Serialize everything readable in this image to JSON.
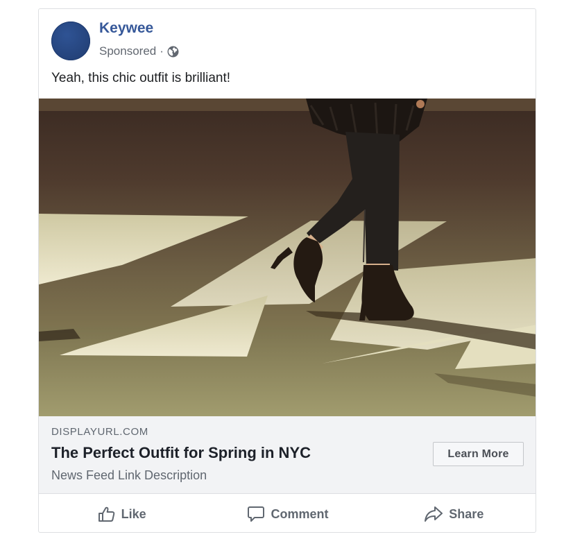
{
  "post": {
    "page_name": "Keywee",
    "sponsored": "Sponsored",
    "separator": "·",
    "privacy_icon": "globe-icon",
    "text": "Yeah, this chic outfit is brilliant!",
    "image_icon": "photo-woman-in-heels-on-crosswalk"
  },
  "link": {
    "display_url": "DISPLAYURL.COM",
    "headline": "The Perfect Outfit for Spring in NYC",
    "description": "News Feed Link Description",
    "cta": "Learn More"
  },
  "actions": {
    "like": "Like",
    "comment": "Comment",
    "share": "Share",
    "like_icon": "thumbs-up-icon",
    "comment_icon": "speech-bubble-icon",
    "share_icon": "share-arrow-icon"
  },
  "colors": {
    "brand": "#365899",
    "link_bg": "#f2f3f5",
    "muted_text": "#606770"
  }
}
